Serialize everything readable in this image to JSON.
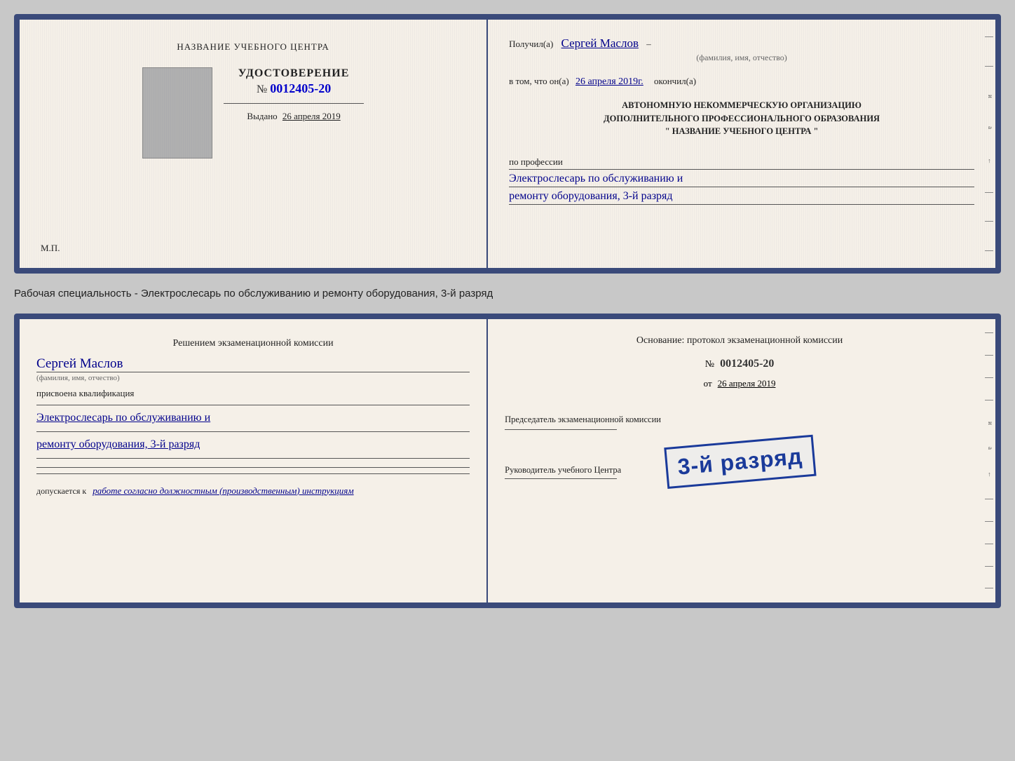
{
  "page": {
    "background": "#c8c8c8"
  },
  "top_card": {
    "left": {
      "title": "НАЗВАНИЕ УЧЕБНОГО ЦЕНТРА",
      "udostoverenie_label": "УДОСТОВЕРЕНИЕ",
      "number_label": "№",
      "number_value": "0012405-20",
      "vydano_label": "Выдано",
      "vydano_date": "26 апреля 2019",
      "mp_label": "М.П."
    },
    "right": {
      "poluchil_prefix": "Получил(а)",
      "recipient_name": "Сергей Маслов",
      "fio_label": "(фамилия, имя, отчество)",
      "vtom_prefix": "в том, что он(а)",
      "vtom_date": "26 апреля 2019г.",
      "okonchil_label": "окончил(а)",
      "org_line1": "АВТОНОМНУЮ НЕКОММЕРЧЕСКУЮ ОРГАНИЗАЦИЮ",
      "org_line2": "ДОПОЛНИТЕЛЬНОГО ПРОФЕССИОНАЛЬНОГО ОБРАЗОВАНИЯ",
      "org_line3": "\"   НАЗВАНИЕ УЧЕБНОГО ЦЕНТРА   \"",
      "po_professii_label": "по профессии",
      "profession_line1": "Электрослесарь по обслуживанию и",
      "profession_line2": "ремонту оборудования, 3-й разряд"
    }
  },
  "middle_text": "Рабочая специальность - Электрослесарь по обслуживанию и ремонту оборудования, 3-й разряд",
  "bottom_card": {
    "left": {
      "resheniem_label": "Решением экзаменационной комиссии",
      "name_hw": "Сергей Маслов",
      "fio_label": "(фамилия, имя, отчество)",
      "prisvoena_label": "присвоена квалификация",
      "prof_line1": "Электрослесарь по обслуживанию и",
      "prof_line2": "ремонту оборудования, 3-й разряд",
      "dopuskaetsya_prefix": "допускается к",
      "dopuskaetsya_hw": "работе согласно должностным (производственным) инструкциям"
    },
    "right": {
      "osnovanie_label": "Основание: протокол экзаменационной комиссии",
      "number_label": "№",
      "number_value": "0012405-20",
      "ot_label": "от",
      "ot_date": "26 апреля 2019",
      "predsedatel_label": "Председатель экзаменационной комиссии",
      "rukovoditel_label": "Руководитель учебного Центра"
    },
    "stamp": {
      "text": "3-й разряд"
    }
  }
}
